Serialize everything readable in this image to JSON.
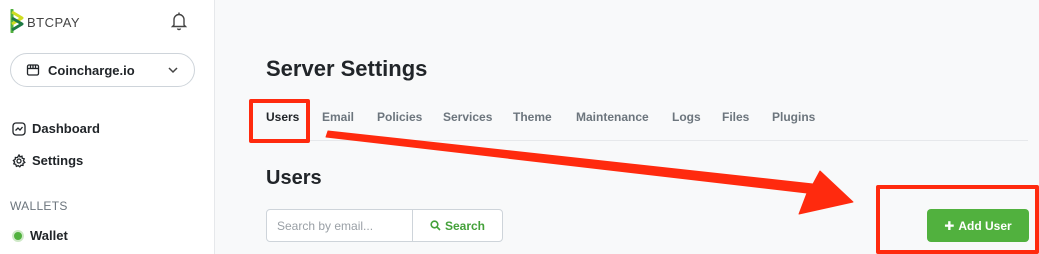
{
  "app": {
    "logo_text": "BTCPAY",
    "store_name": "Coincharge.io"
  },
  "sidebar": {
    "items": [
      {
        "label": "Dashboard",
        "icon": "dashboard-icon"
      },
      {
        "label": "Settings",
        "icon": "gear-icon"
      }
    ],
    "section_wallets": "WALLETS",
    "wallet_item": {
      "label": "Wallet",
      "icon": "wallet-status-dot"
    }
  },
  "main": {
    "page_title": "Server Settings",
    "tabs": [
      {
        "label": "Users",
        "active": true
      },
      {
        "label": "Email"
      },
      {
        "label": "Policies"
      },
      {
        "label": "Services"
      },
      {
        "label": "Theme"
      },
      {
        "label": "Maintenance"
      },
      {
        "label": "Logs"
      },
      {
        "label": "Files"
      },
      {
        "label": "Plugins"
      }
    ],
    "section_title": "Users",
    "search": {
      "placeholder": "Search by email...",
      "button_label": "Search"
    },
    "add_user_label": "Add User"
  },
  "colors": {
    "brand_green": "#51b13e",
    "annotation_red": "#ff2a0e"
  }
}
